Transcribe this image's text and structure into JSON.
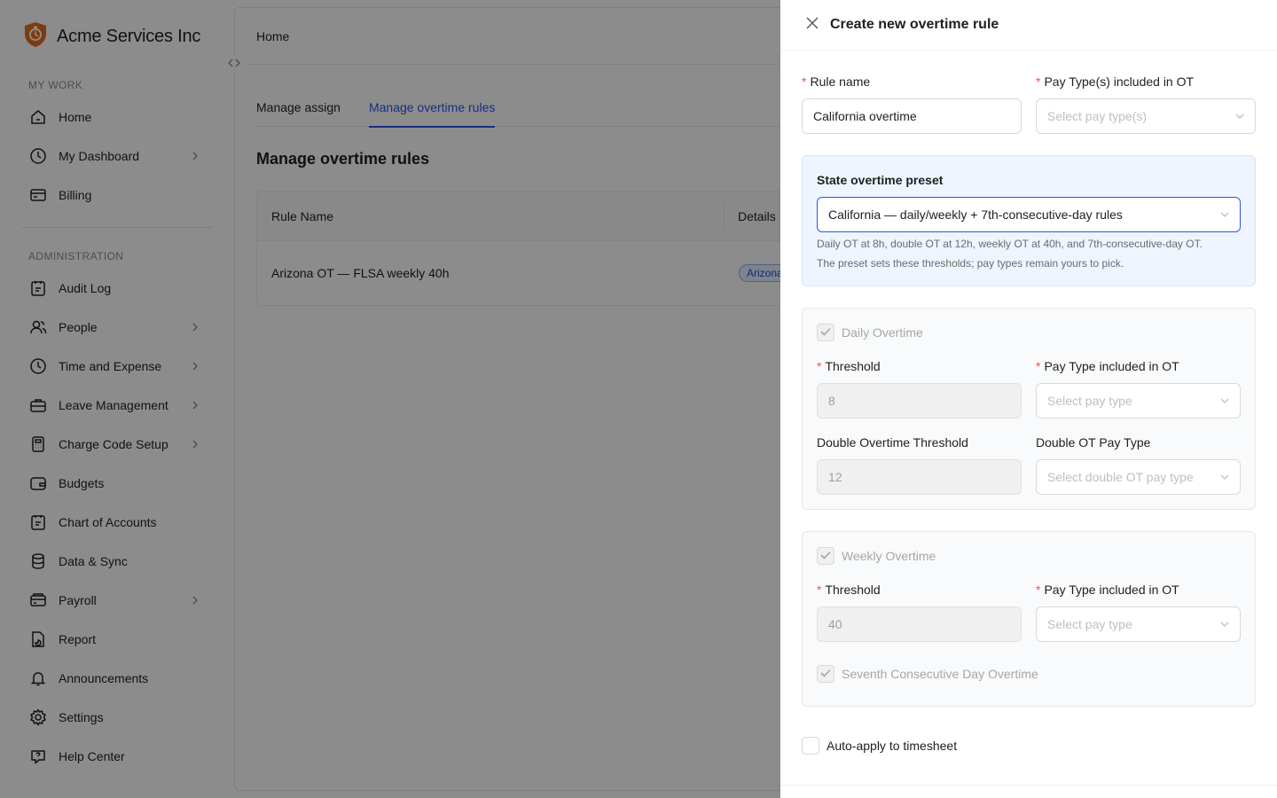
{
  "brand": {
    "name": "Acme Services Inc",
    "logo_icon": "shield-clock-icon",
    "accent": "#e86a1e"
  },
  "sidebar": {
    "sections": [
      {
        "label": "MY WORK",
        "items": [
          {
            "label": "Home",
            "icon": "home-icon",
            "has_children": false
          },
          {
            "label": "My Dashboard",
            "icon": "clock-icon",
            "has_children": true
          },
          {
            "label": "Billing",
            "icon": "billing-icon",
            "has_children": false
          }
        ]
      },
      {
        "label": "ADMINISTRATION",
        "items": [
          {
            "label": "Audit Log",
            "icon": "clipboard-icon",
            "has_children": false
          },
          {
            "label": "People",
            "icon": "people-icon",
            "has_children": true
          },
          {
            "label": "Time and Expense",
            "icon": "clock-icon",
            "has_children": true
          },
          {
            "label": "Leave Management",
            "icon": "briefcase-icon",
            "has_children": true
          },
          {
            "label": "Charge Code Setup",
            "icon": "calculator-icon",
            "has_children": true
          },
          {
            "label": "Budgets",
            "icon": "wallet-icon",
            "has_children": false
          },
          {
            "label": "Chart of Accounts",
            "icon": "clipboard-icon",
            "has_children": false
          },
          {
            "label": "Data & Sync",
            "icon": "database-icon",
            "has_children": false
          },
          {
            "label": "Payroll",
            "icon": "payroll-icon",
            "has_children": true
          },
          {
            "label": "Report",
            "icon": "report-icon",
            "has_children": false
          },
          {
            "label": "Announcements",
            "icon": "bell-icon",
            "has_children": false
          },
          {
            "label": "Settings",
            "icon": "gear-icon",
            "has_children": false
          },
          {
            "label": "Help Center",
            "icon": "help-icon",
            "has_children": false
          }
        ]
      }
    ]
  },
  "main": {
    "breadcrumb": "Home",
    "tabs": [
      {
        "label": "Manage assign",
        "active": false
      },
      {
        "label": "Manage overtime rules",
        "active": true
      }
    ],
    "title": "Manage overtime rules",
    "table": {
      "columns": [
        "Rule Name",
        "Details"
      ],
      "rows": [
        {
          "rule_name": "Arizona OT — FLSA weekly 40h",
          "details_tag": "Arizona"
        }
      ]
    }
  },
  "drawer": {
    "title": "Create new overtime rule",
    "rule_name": {
      "label": "Rule name",
      "value": "California overtime"
    },
    "pay_types": {
      "label": "Pay Type(s) included in OT",
      "placeholder": "Select pay type(s)"
    },
    "preset": {
      "title": "State overtime preset",
      "value": "California — daily/weekly + 7th-consecutive-day rules",
      "help_line1": "Daily OT at 8h, double OT at 12h, weekly OT at 40h, and 7th-consecutive-day OT.",
      "help_line2": "The preset sets these thresholds; pay types remain yours to pick."
    },
    "daily": {
      "label": "Daily Overtime",
      "checked": true,
      "threshold_label": "Threshold",
      "threshold_value": "8",
      "pay_type_label": "Pay Type included in OT",
      "pay_type_placeholder": "Select pay type",
      "double_threshold_label": "Double Overtime Threshold",
      "double_threshold_value": "12",
      "double_pay_type_label": "Double OT Pay Type",
      "double_pay_type_placeholder": "Select double OT pay type"
    },
    "weekly": {
      "label": "Weekly Overtime",
      "checked": true,
      "threshold_label": "Threshold",
      "threshold_value": "40",
      "pay_type_label": "Pay Type included in OT",
      "pay_type_placeholder": "Select pay type",
      "seventh_day_label": "Seventh Consecutive Day Overtime",
      "seventh_day_checked": true
    },
    "auto_apply": {
      "label": "Auto-apply to timesheet",
      "checked": false
    }
  },
  "colors": {
    "primary": "#2f54eb",
    "required": "#ff4d4f",
    "preset_bg": "#eef5ff",
    "overlay": "rgba(0,0,0,0.45)"
  }
}
